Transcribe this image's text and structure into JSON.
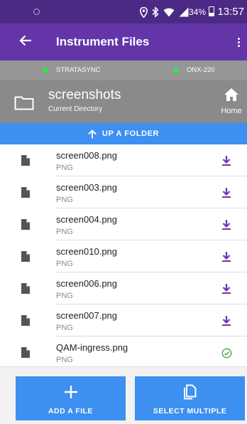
{
  "status_bar": {
    "battery_text": "34%",
    "time": "13:57",
    "icons": [
      "notification-dot-icon",
      "location-icon",
      "bluetooth-icon",
      "wifi-icon",
      "signal-icon",
      "battery-icon"
    ]
  },
  "app_bar": {
    "title": "Instrument Files",
    "back_icon": "arrow-left-icon",
    "menu_icon": "more-vert-icon"
  },
  "connections": [
    {
      "label": "STRATASYNC",
      "status_color": "#34e34a"
    },
    {
      "label": "ONX-220",
      "status_color": "#34e34a"
    }
  ],
  "directory": {
    "name": "screenshots",
    "subtitle": "Current Directory",
    "home_label": "Home"
  },
  "up_folder_label": "UP A FOLDER",
  "files": [
    {
      "name": "screen008.png",
      "type": "PNG",
      "action": "download"
    },
    {
      "name": "screen003.png",
      "type": "PNG",
      "action": "download"
    },
    {
      "name": "screen004.png",
      "type": "PNG",
      "action": "download"
    },
    {
      "name": "screen010.png",
      "type": "PNG",
      "action": "download"
    },
    {
      "name": "screen006.png",
      "type": "PNG",
      "action": "download"
    },
    {
      "name": "screen007.png",
      "type": "PNG",
      "action": "download"
    },
    {
      "name": "QAM-ingress.png",
      "type": "PNG",
      "action": "downloaded"
    }
  ],
  "buttons": {
    "add_file": "ADD A FILE",
    "select_multiple": "SELECT MULTIPLE"
  },
  "colors": {
    "status_bar": "#4a2a85",
    "app_bar": "#6435a8",
    "accent_blue": "#3d8ff0",
    "download_purple": "#6b35b0",
    "success_green": "#4caf50",
    "connected_green": "#34e34a"
  }
}
